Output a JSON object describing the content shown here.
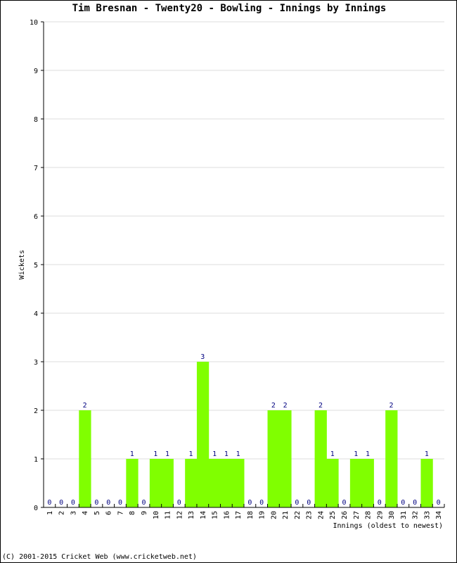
{
  "chart_data": {
    "type": "bar",
    "title": "Tim Bresnan - Twenty20 - Bowling - Innings by Innings",
    "xlabel": "Innings (oldest to newest)",
    "ylabel": "Wickets",
    "ylim": [
      0,
      10
    ],
    "yticks": [
      0,
      1,
      2,
      3,
      4,
      5,
      6,
      7,
      8,
      9,
      10
    ],
    "grid": true,
    "categories": [
      "1",
      "2",
      "3",
      "4",
      "5",
      "6",
      "7",
      "8",
      "9",
      "10",
      "11",
      "12",
      "13",
      "14",
      "15",
      "16",
      "17",
      "18",
      "19",
      "20",
      "21",
      "22",
      "23",
      "24",
      "25",
      "26",
      "27",
      "28",
      "29",
      "30",
      "31",
      "32",
      "33",
      "34"
    ],
    "values": [
      0,
      0,
      0,
      2,
      0,
      0,
      0,
      1,
      0,
      1,
      1,
      0,
      1,
      3,
      1,
      1,
      1,
      0,
      0,
      2,
      2,
      0,
      0,
      2,
      1,
      0,
      1,
      1,
      0,
      2,
      0,
      0,
      1,
      0
    ],
    "bar_color": "#80ff00",
    "label_color": "#000080",
    "grid_color": "#dddddd"
  },
  "footer": "(C) 2001-2015 Cricket Web (www.cricketweb.net)"
}
